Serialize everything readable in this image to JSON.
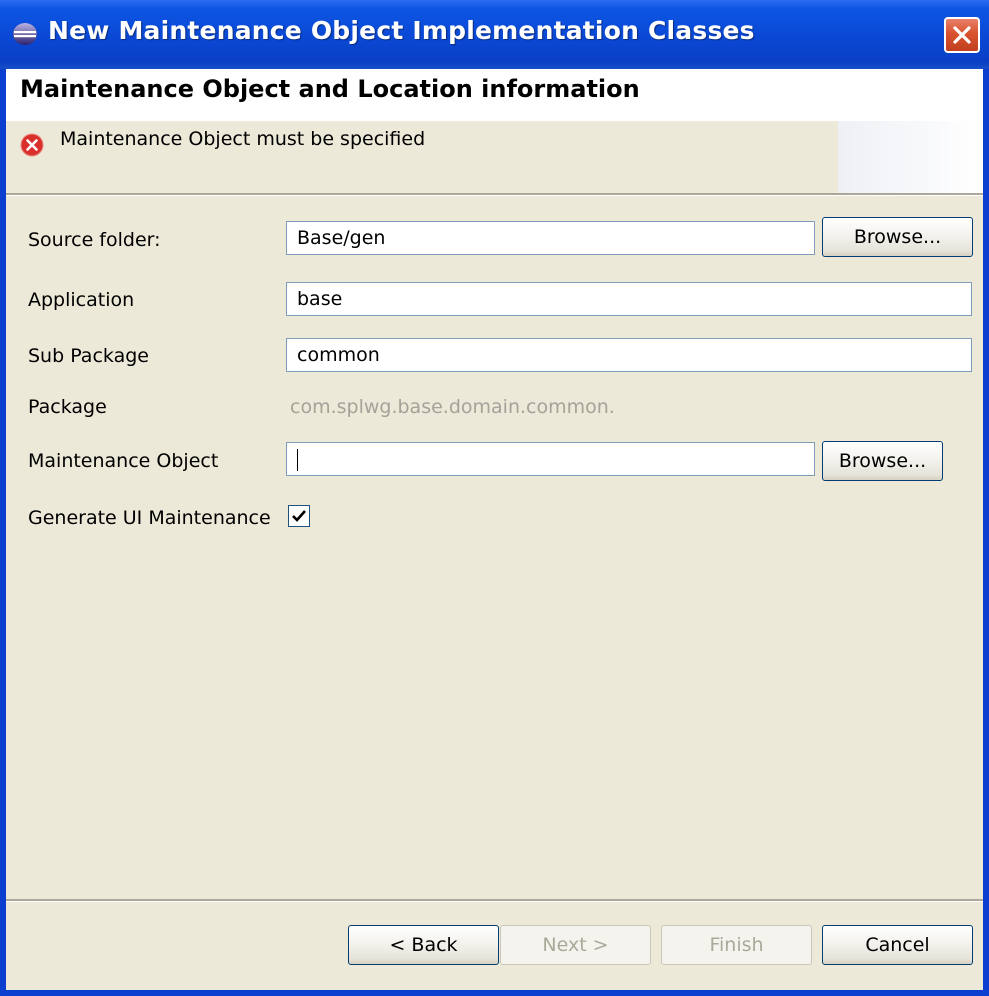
{
  "window": {
    "title": "New Maintenance Object Implementation Classes"
  },
  "banner": {
    "title": "Maintenance Object and Location information",
    "message": "Maintenance Object must be specified"
  },
  "form": {
    "source_folder": {
      "label": "Source folder:",
      "value": "Base/gen",
      "browse_label": "Browse..."
    },
    "application": {
      "label": "Application",
      "value": "base"
    },
    "sub_package": {
      "label": "Sub Package",
      "value": "common"
    },
    "package": {
      "label": "Package",
      "value": "com.splwg.base.domain.common."
    },
    "maintenance_object": {
      "label": "Maintenance Object",
      "value": "",
      "browse_label": "Browse..."
    },
    "generate_ui": {
      "label": "Generate UI Maintenance",
      "checked": true
    }
  },
  "buttons": {
    "back": "< Back",
    "next": "Next >",
    "finish": "Finish",
    "cancel": "Cancel"
  },
  "colors": {
    "titlebar": "#0a48d4",
    "dialog_background": "#ece9d8",
    "error": "#d9302c",
    "disabled_text": "#aca899"
  }
}
